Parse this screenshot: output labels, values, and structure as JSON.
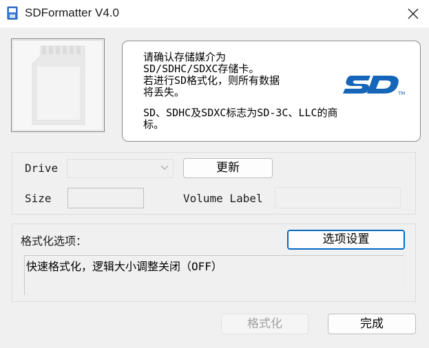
{
  "window": {
    "title": "SDFormatter V4.0"
  },
  "info": {
    "lines": [
      "请确认存储媒介为",
      "SD/SDHC/SDXC存储卡。",
      "若进行SD格式化，则所有数据",
      "将丢失。",
      "SD、SDHC及SDXC标志为SD-3C、LLC的商",
      "标。"
    ]
  },
  "drive": {
    "drive_label": "Drive",
    "drive_value": "",
    "refresh_button": "更新",
    "size_label": "Size",
    "size_value": "",
    "volume_label": "Volume Label",
    "volume_value": ""
  },
  "options": {
    "label": "格式化选项：",
    "settings_button": "选项设置",
    "summary": "快速格式化，逻辑大小调整关闭（OFF）"
  },
  "footer": {
    "format_button": "格式化",
    "done_button": "完成"
  },
  "colors": {
    "accent": "#0067c0",
    "sd_logo": "#1565b8"
  },
  "icons": [
    "app-icon",
    "close-icon",
    "sd-card-icon",
    "sd-logo",
    "chevron-down-icon"
  ]
}
